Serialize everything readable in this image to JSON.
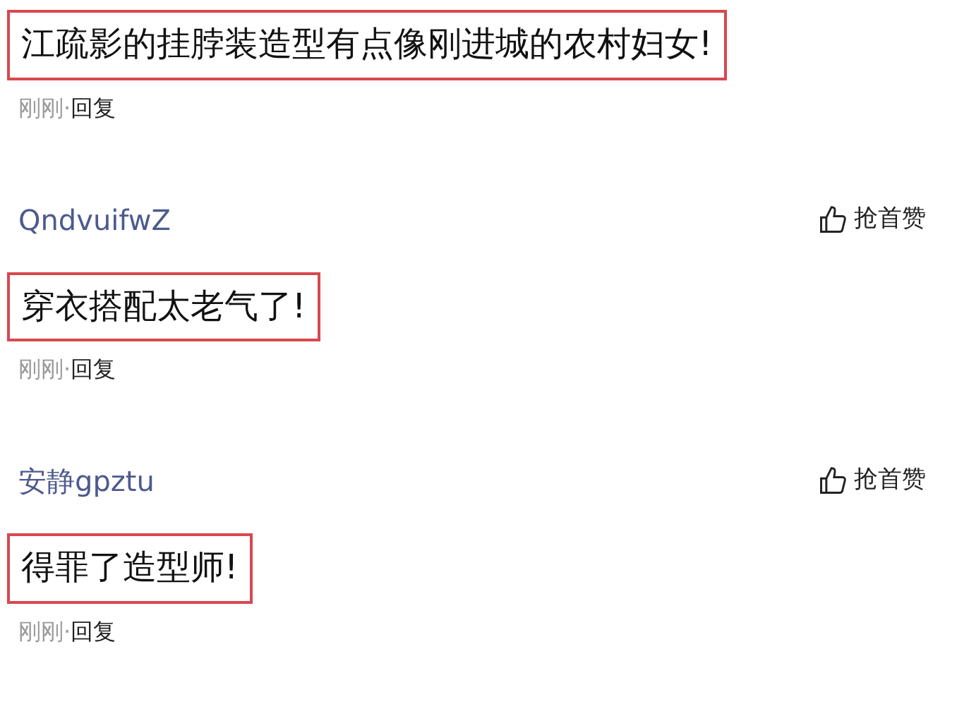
{
  "comments": [
    {
      "text": "江疏影的挂脖装造型有点像刚进城的农村妇女!",
      "highlighted": true,
      "time": "刚刚",
      "separator": "·",
      "reply": "回复"
    },
    {
      "author": "QndvuifwZ",
      "like": "抢首赞",
      "text": "穿衣搭配太老气了!",
      "highlighted": true,
      "time": "刚刚",
      "separator": "·",
      "reply": "回复"
    },
    {
      "author": "安静gpztu",
      "like": "抢首赞",
      "text": "得罪了造型师!",
      "highlighted": true,
      "time": "刚刚",
      "separator": "·",
      "reply": "回复"
    }
  ]
}
